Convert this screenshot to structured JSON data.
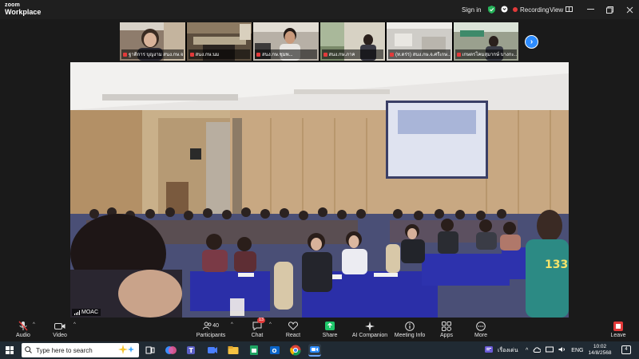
{
  "app": {
    "brand_top": "zoom",
    "brand_bottom": "Workplace"
  },
  "titlebar": {
    "signin": "Sign in",
    "recording": "Recording",
    "view": "View"
  },
  "thumbnails": [
    {
      "label": "ฐาติการ บุญงาม สนง.กษ.จ...",
      "muted": true,
      "bg": "#8a7a6a"
    },
    {
      "label": "สนง.กษ.นม",
      "muted": true,
      "bg": "#6d6050"
    },
    {
      "label": "สนง.กษ.ชุมพ...",
      "muted": true,
      "bg": "#b8b2a8"
    },
    {
      "label": "สนง.กษ.ภาค",
      "muted": true,
      "bg": "#7e8e6e"
    },
    {
      "label": "(ท.ดร่ร) สนง.กษ.จ.ศรีเกษ...",
      "muted": true,
      "bg": "#c8c6c2"
    },
    {
      "label": "เกษตรโคมสุมากษ์ บางกะ...",
      "muted": true,
      "bg": "#9aa292"
    }
  ],
  "main_video": {
    "label": "MOAC"
  },
  "toolbar": {
    "audio": "Audio",
    "video": "Video",
    "participants": "Participants",
    "participants_count": "40",
    "chat": "Chat",
    "chat_badge": "13",
    "react": "React",
    "share": "Share",
    "ai": "AI Companion",
    "info": "Meeting Info",
    "apps": "Apps",
    "more": "More",
    "leave": "Leave"
  },
  "taskbar": {
    "search_placeholder": "Type here to search",
    "weather": "เรื่องเด่น",
    "lang": "ENG",
    "time": "10:02",
    "date": "14/8/2568",
    "notifications": "4"
  },
  "colors": {
    "accent": "#2d8cff",
    "record": "#e23a3a",
    "share": "#1fc76a",
    "leave": "#e23a3a"
  }
}
